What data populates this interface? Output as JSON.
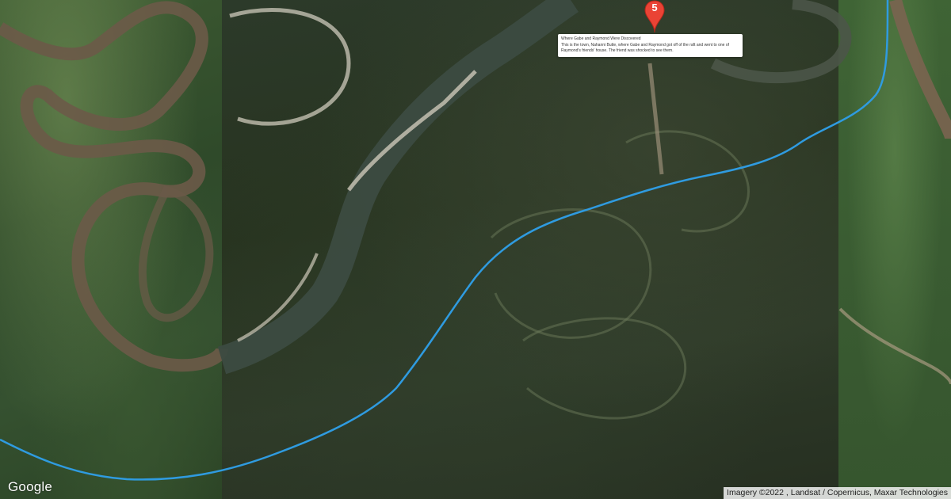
{
  "map": {
    "provider_logo": "Google",
    "attribution": "Imagery ©2022 , Landsat / Copernicus, Maxar Technologies",
    "route_color": "#2f9be0"
  },
  "marker": {
    "label": "5",
    "color": "#ea4335",
    "icon": "map-pin-icon"
  },
  "info_window": {
    "title": "Where Gabe and Raymond Were Discovered",
    "body": "This is the town, Nahanni Butte, where Gabe and Raymond got off of the raft and went to one of Raymond's friends' house. The friend was shocked to see them."
  }
}
